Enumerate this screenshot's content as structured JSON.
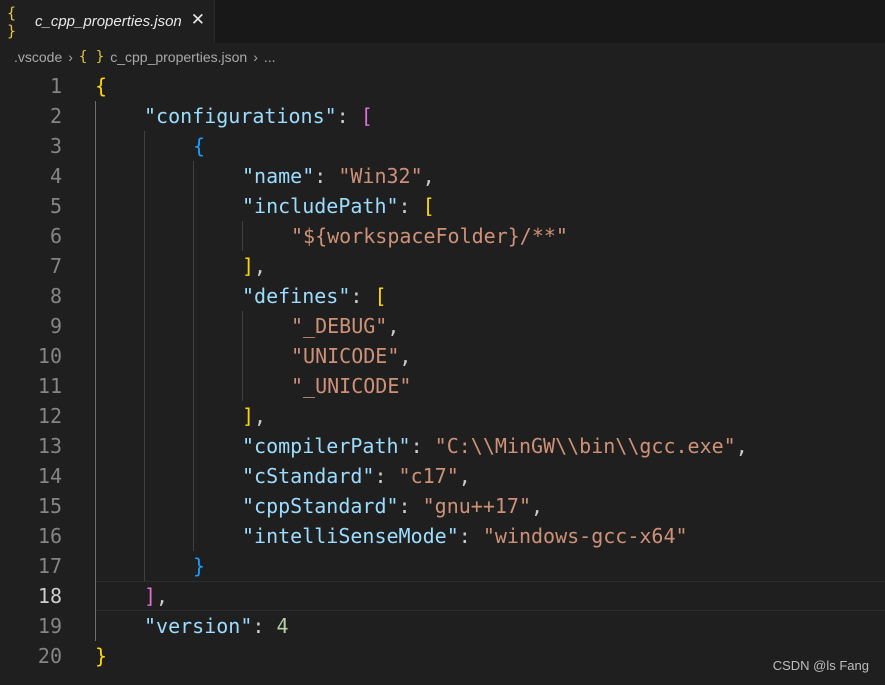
{
  "tab": {
    "icon": "{ }",
    "title": "c_cpp_properties.json",
    "close": "✕"
  },
  "breadcrumb": {
    "folder": ".vscode",
    "file_icon": "{ }",
    "file": "c_cpp_properties.json",
    "more": "..."
  },
  "editor": {
    "active_line": 18,
    "lines": [
      {
        "n": "1",
        "indent": 0,
        "tokens": [
          {
            "t": "{",
            "c": "b1"
          }
        ]
      },
      {
        "n": "2",
        "indent": 1,
        "tokens": [
          {
            "t": "\"configurations\"",
            "c": "key"
          },
          {
            "t": ": ",
            "c": "punc"
          },
          {
            "t": "[",
            "c": "b2"
          }
        ]
      },
      {
        "n": "3",
        "indent": 2,
        "tokens": [
          {
            "t": "{",
            "c": "b3"
          }
        ]
      },
      {
        "n": "4",
        "indent": 3,
        "tokens": [
          {
            "t": "\"name\"",
            "c": "key"
          },
          {
            "t": ": ",
            "c": "punc"
          },
          {
            "t": "\"Win32\"",
            "c": "str"
          },
          {
            "t": ",",
            "c": "punc"
          }
        ]
      },
      {
        "n": "5",
        "indent": 3,
        "tokens": [
          {
            "t": "\"includePath\"",
            "c": "key"
          },
          {
            "t": ": ",
            "c": "punc"
          },
          {
            "t": "[",
            "c": "b1"
          }
        ]
      },
      {
        "n": "6",
        "indent": 4,
        "tokens": [
          {
            "t": "\"${workspaceFolder}/**\"",
            "c": "str"
          }
        ]
      },
      {
        "n": "7",
        "indent": 3,
        "tokens": [
          {
            "t": "]",
            "c": "b1"
          },
          {
            "t": ",",
            "c": "punc"
          }
        ]
      },
      {
        "n": "8",
        "indent": 3,
        "tokens": [
          {
            "t": "\"defines\"",
            "c": "key"
          },
          {
            "t": ": ",
            "c": "punc"
          },
          {
            "t": "[",
            "c": "b1"
          }
        ]
      },
      {
        "n": "9",
        "indent": 4,
        "tokens": [
          {
            "t": "\"_DEBUG\"",
            "c": "str"
          },
          {
            "t": ",",
            "c": "punc"
          }
        ]
      },
      {
        "n": "10",
        "indent": 4,
        "tokens": [
          {
            "t": "\"UNICODE\"",
            "c": "str"
          },
          {
            "t": ",",
            "c": "punc"
          }
        ]
      },
      {
        "n": "11",
        "indent": 4,
        "tokens": [
          {
            "t": "\"_UNICODE\"",
            "c": "str"
          }
        ]
      },
      {
        "n": "12",
        "indent": 3,
        "tokens": [
          {
            "t": "]",
            "c": "b1"
          },
          {
            "t": ",",
            "c": "punc"
          }
        ]
      },
      {
        "n": "13",
        "indent": 3,
        "tokens": [
          {
            "t": "\"compilerPath\"",
            "c": "key"
          },
          {
            "t": ": ",
            "c": "punc"
          },
          {
            "t": "\"C:\\\\MinGW\\\\bin\\\\gcc.exe\"",
            "c": "str"
          },
          {
            "t": ",",
            "c": "punc"
          }
        ]
      },
      {
        "n": "14",
        "indent": 3,
        "tokens": [
          {
            "t": "\"cStandard\"",
            "c": "key"
          },
          {
            "t": ": ",
            "c": "punc"
          },
          {
            "t": "\"c17\"",
            "c": "str"
          },
          {
            "t": ",",
            "c": "punc"
          }
        ]
      },
      {
        "n": "15",
        "indent": 3,
        "tokens": [
          {
            "t": "\"cppStandard\"",
            "c": "key"
          },
          {
            "t": ": ",
            "c": "punc"
          },
          {
            "t": "\"gnu++17\"",
            "c": "str"
          },
          {
            "t": ",",
            "c": "punc"
          }
        ]
      },
      {
        "n": "16",
        "indent": 3,
        "tokens": [
          {
            "t": "\"intelliSenseMode\"",
            "c": "key"
          },
          {
            "t": ": ",
            "c": "punc"
          },
          {
            "t": "\"windows-gcc-x64\"",
            "c": "str"
          }
        ]
      },
      {
        "n": "17",
        "indent": 2,
        "tokens": [
          {
            "t": "}",
            "c": "b3"
          }
        ]
      },
      {
        "n": "18",
        "indent": 1,
        "tokens": [
          {
            "t": "]",
            "c": "b2"
          },
          {
            "t": ",",
            "c": "punc"
          }
        ]
      },
      {
        "n": "19",
        "indent": 1,
        "tokens": [
          {
            "t": "\"version\"",
            "c": "key"
          },
          {
            "t": ": ",
            "c": "punc"
          },
          {
            "t": "4",
            "c": "num"
          }
        ]
      },
      {
        "n": "20",
        "indent": 0,
        "tokens": [
          {
            "t": "}",
            "c": "b1"
          }
        ]
      }
    ]
  },
  "watermark": "CSDN @ls Fang",
  "colors": {
    "background": "#1f1f1f",
    "key": "#9cdcfe",
    "string": "#ce9178",
    "number": "#b5cea8",
    "bracket_level1": "#ffd700",
    "bracket_level2": "#da70d6",
    "bracket_level3": "#179fff"
  }
}
